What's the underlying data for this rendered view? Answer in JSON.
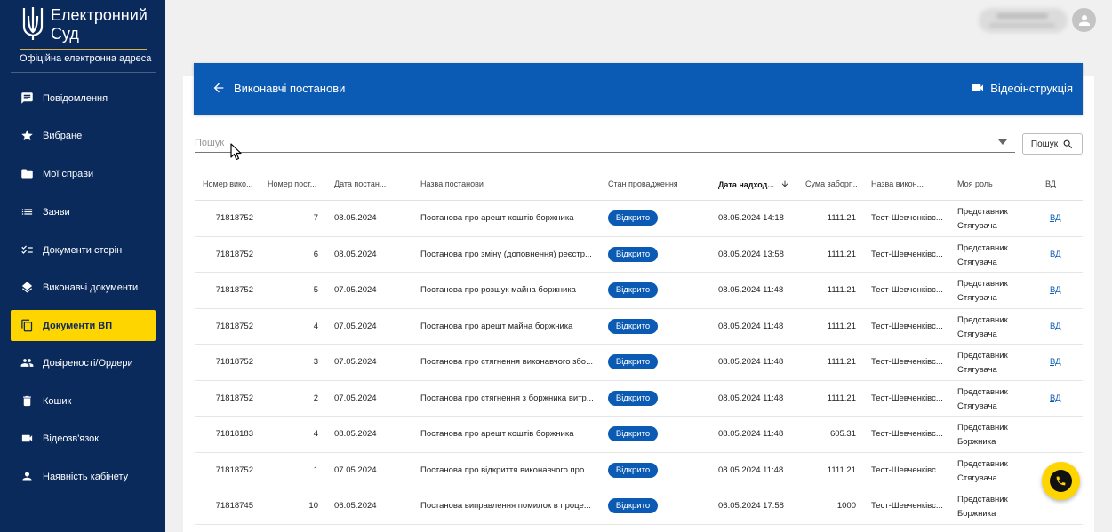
{
  "brand": {
    "title": "Електронний Суд",
    "subtitle": "Офіційна електронна адреса"
  },
  "sidebar": {
    "items": [
      {
        "label": "Повідомлення",
        "icon": "message-icon",
        "active": false
      },
      {
        "label": "Вибране",
        "icon": "star-icon",
        "active": false
      },
      {
        "label": "Мої справи",
        "icon": "folder-icon",
        "active": false
      },
      {
        "label": "Заяви",
        "icon": "list-icon",
        "active": false
      },
      {
        "label": "Документи сторін",
        "icon": "checklist-icon",
        "active": false
      },
      {
        "label": "Виконавчі документи",
        "icon": "layers-icon",
        "active": false
      },
      {
        "label": "Документи ВП",
        "icon": "copy-icon",
        "active": true
      },
      {
        "label": "Довіреності/Ордери",
        "icon": "people-icon",
        "active": false
      },
      {
        "label": "Кошик",
        "icon": "trash-icon",
        "active": false
      },
      {
        "label": "Відеозв'язок",
        "icon": "videocam-icon",
        "active": false
      },
      {
        "label": "Наявність кабінету",
        "icon": "person-icon",
        "active": false
      }
    ]
  },
  "header": {
    "title": "Виконавчі постанови",
    "video_label": "Відеоінструкція"
  },
  "search": {
    "placeholder": "Пошук",
    "button_label": "Пошук"
  },
  "table": {
    "columns": [
      "Номер вико...",
      "Номер пост...",
      "Дата постан...",
      "Назва постанови",
      "Стан провадження",
      "Дата надход...",
      "Сума заборг...",
      "Назва викон...",
      "Моя роль",
      "ВД"
    ],
    "sorted_column": "Дата надход...",
    "rows": [
      {
        "exec_no": "71818752",
        "decree_no": "7",
        "decree_date": "08.05.2024",
        "name": "Постанова про арешт коштів боржника",
        "status": "Відкрито",
        "received": "08.05.2024 14:18",
        "amount": "1111.21",
        "executor": "Тест-Шевченківс...",
        "role_1": "Представник",
        "role_2": "Стягувача",
        "vd": "ВД"
      },
      {
        "exec_no": "71818752",
        "decree_no": "6",
        "decree_date": "08.05.2024",
        "name": "Постанова про зміну (доповнення) реєстр...",
        "status": "Відкрито",
        "received": "08.05.2024 13:58",
        "amount": "1111.21",
        "executor": "Тест-Шевченківс...",
        "role_1": "Представник",
        "role_2": "Стягувача",
        "vd": "ВД"
      },
      {
        "exec_no": "71818752",
        "decree_no": "5",
        "decree_date": "07.05.2024",
        "name": "Постанова про розшук майна боржника",
        "status": "Відкрито",
        "received": "08.05.2024 11:48",
        "amount": "1111.21",
        "executor": "Тест-Шевченківс...",
        "role_1": "Представник",
        "role_2": "Стягувача",
        "vd": "ВД"
      },
      {
        "exec_no": "71818752",
        "decree_no": "4",
        "decree_date": "07.05.2024",
        "name": "Постанова про арешт майна боржника",
        "status": "Відкрито",
        "received": "08.05.2024 11:48",
        "amount": "1111.21",
        "executor": "Тест-Шевченківс...",
        "role_1": "Представник",
        "role_2": "Стягувача",
        "vd": "ВД"
      },
      {
        "exec_no": "71818752",
        "decree_no": "3",
        "decree_date": "07.05.2024",
        "name": "Постанова про стягнення виконавчого збо...",
        "status": "Відкрито",
        "received": "08.05.2024 11:48",
        "amount": "1111.21",
        "executor": "Тест-Шевченківс...",
        "role_1": "Представник",
        "role_2": "Стягувача",
        "vd": "ВД"
      },
      {
        "exec_no": "71818752",
        "decree_no": "2",
        "decree_date": "07.05.2024",
        "name": "Постанова про стягнення з боржника витр...",
        "status": "Відкрито",
        "received": "08.05.2024 11:48",
        "amount": "1111.21",
        "executor": "Тест-Шевченківс...",
        "role_1": "Представник",
        "role_2": "Стягувача",
        "vd": "ВД"
      },
      {
        "exec_no": "71818183",
        "decree_no": "4",
        "decree_date": "08.05.2024",
        "name": "Постанова про арешт коштів боржника",
        "status": "Відкрито",
        "received": "08.05.2024 11:48",
        "amount": "605.31",
        "executor": "Тест-Шевченківс...",
        "role_1": "Представник",
        "role_2": "Боржника",
        "vd": ""
      },
      {
        "exec_no": "71818752",
        "decree_no": "1",
        "decree_date": "07.05.2024",
        "name": "Постанова про відкриття виконавчого про...",
        "status": "Відкрито",
        "received": "08.05.2024 11:48",
        "amount": "1111.21",
        "executor": "Тест-Шевченківс...",
        "role_1": "Представник",
        "role_2": "Стягувача",
        "vd": ""
      },
      {
        "exec_no": "71818745",
        "decree_no": "10",
        "decree_date": "06.05.2024",
        "name": "Постанова виправлення помилок в проце...",
        "status": "Відкрито",
        "received": "06.05.2024 17:58",
        "amount": "1000",
        "executor": "Тест-Шевченківс...",
        "role_1": "Представник",
        "role_2": "Боржника",
        "vd": ""
      }
    ]
  },
  "colors": {
    "sidebar_bg": "#0a2a5c",
    "accent_yellow": "#ffd500",
    "primary_blue": "#0b5bb5"
  }
}
